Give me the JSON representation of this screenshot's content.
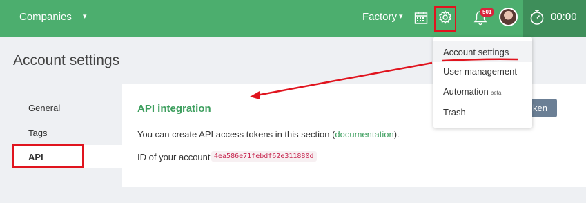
{
  "topbar": {
    "companies_label": "Companies",
    "companies_caret": "▾",
    "factory_label": "Factory",
    "factory_caret": "▾",
    "notification_count": "501",
    "timer_value": "00:00"
  },
  "page": {
    "title": "Account settings"
  },
  "sidebar": {
    "items": [
      {
        "label": "General"
      },
      {
        "label": "Tags"
      },
      {
        "label": "API"
      }
    ]
  },
  "main": {
    "title": "API integration",
    "desc_prefix": "You can create API access tokens in this section (",
    "desc_link": "documentation",
    "desc_suffix": ").",
    "id_label": "ID of your account:",
    "id_value": "4ea586e71febdf62e311880d",
    "token_button_label": "ken"
  },
  "dropdown": {
    "items": [
      {
        "label": "Account settings"
      },
      {
        "label": "User management"
      },
      {
        "label": "Automation",
        "badge": "beta"
      },
      {
        "label": "Trash"
      }
    ]
  },
  "colors": {
    "topbar": "#4cae6e",
    "accent_green": "#3e9f5f",
    "annotation_red": "#e0141e",
    "badge": "#d9233b"
  },
  "icons": [
    "calendar-icon",
    "gear-icon",
    "bell-icon",
    "timer-icon"
  ]
}
